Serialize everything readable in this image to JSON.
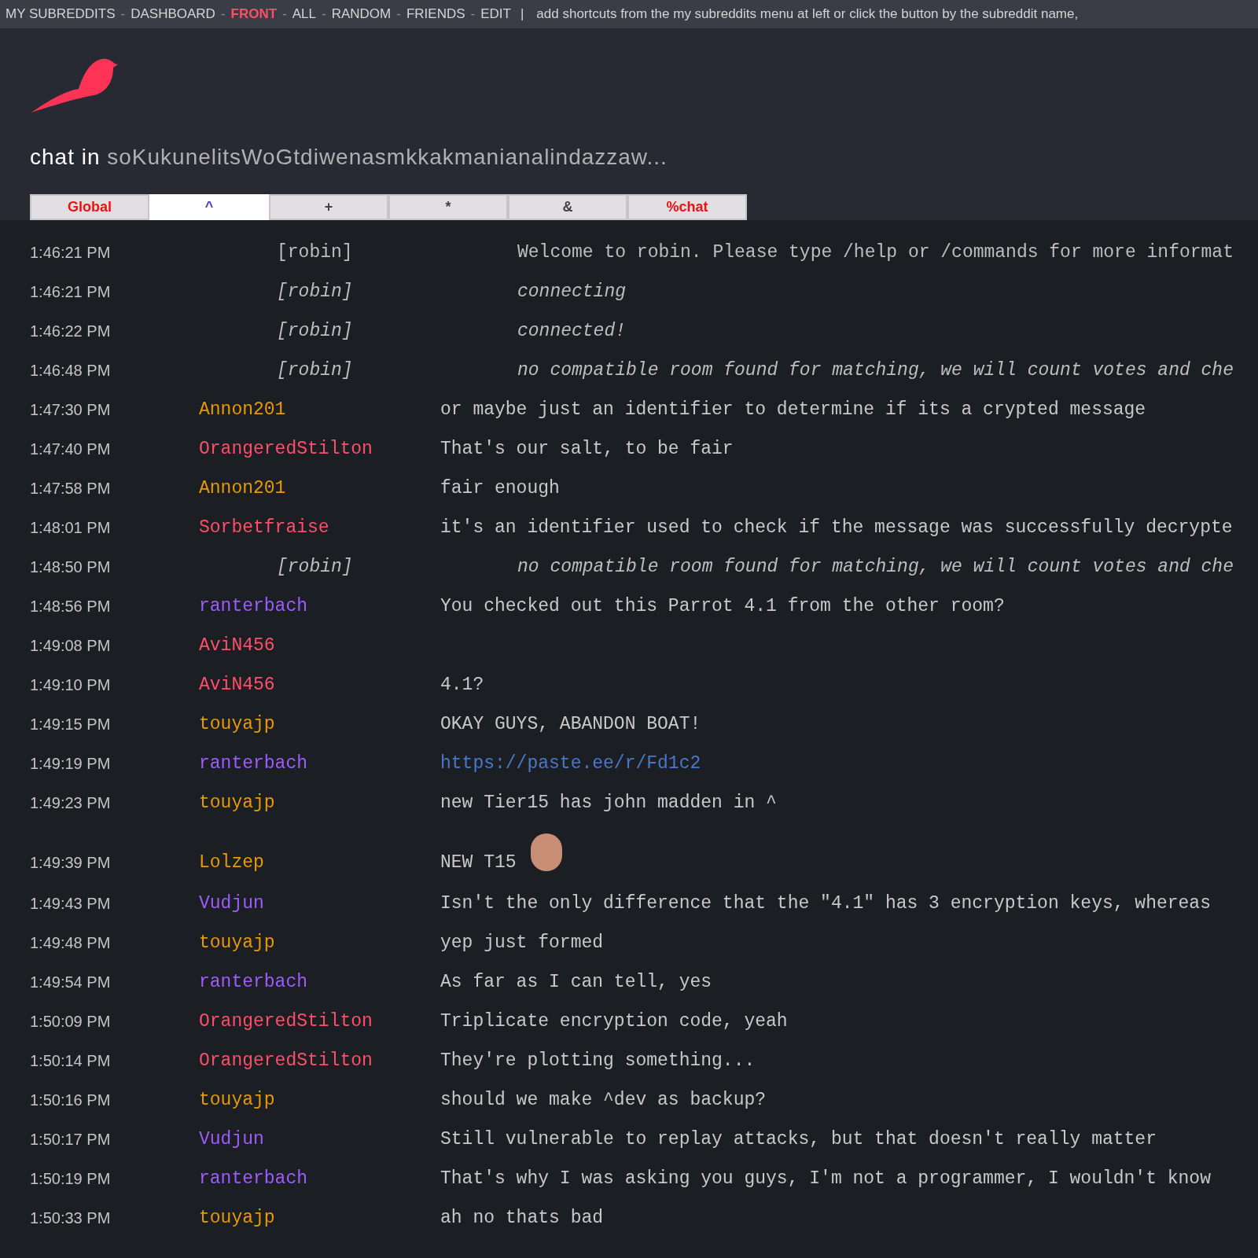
{
  "top_bar": {
    "separator": "-",
    "divider": "|",
    "links": [
      {
        "label": "MY SUBREDDITS",
        "selected": false
      },
      {
        "label": "DASHBOARD",
        "selected": false
      },
      {
        "label": "FRONT",
        "selected": true
      },
      {
        "label": "ALL",
        "selected": false
      },
      {
        "label": "RANDOM",
        "selected": false
      },
      {
        "label": "FRIENDS",
        "selected": false
      },
      {
        "label": "EDIT",
        "selected": false
      }
    ],
    "hint": "add shortcuts from the my subreddits menu at left or click the button by the subreddit name,"
  },
  "header": {
    "prefix": "chat in",
    "room": "soKukunelitsWoGtdiwenasmkkakmanianalindazzaw..."
  },
  "tabs": [
    {
      "label": "Global",
      "selected": false,
      "color": "#ee1111"
    },
    {
      "label": "^",
      "selected": true,
      "color": "#5533cc"
    },
    {
      "label": "+",
      "selected": false,
      "color": "#444444"
    },
    {
      "label": "*",
      "selected": false,
      "color": "#444444"
    },
    {
      "label": "&",
      "selected": false,
      "color": "#444444"
    },
    {
      "label": "%chat",
      "selected": false,
      "color": "#ee1111"
    }
  ],
  "messages": [
    {
      "kind": "system",
      "time": "1:46:21 PM",
      "user": "[robin]",
      "text": "Welcome to robin. Please type /help or /commands for more informat",
      "italic": false
    },
    {
      "kind": "system",
      "time": "1:46:21 PM",
      "user": "[robin]",
      "text": "connecting",
      "italic": true
    },
    {
      "kind": "system",
      "time": "1:46:22 PM",
      "user": "[robin]",
      "text": "connected!",
      "italic": true
    },
    {
      "kind": "system",
      "time": "1:46:48 PM",
      "user": "[robin]",
      "text": "no compatible room found for matching, we will count votes and che",
      "italic": true
    },
    {
      "kind": "chat",
      "time": "1:47:30 PM",
      "user": "Annon201",
      "color": "#e89a00",
      "text": "or maybe just an identifier to determine if its a crypted message"
    },
    {
      "kind": "chat",
      "time": "1:47:40 PM",
      "user": "OrangeredStilton",
      "color": "#ff4f68",
      "text": "That's our salt, to be fair"
    },
    {
      "kind": "chat",
      "time": "1:47:58 PM",
      "user": "Annon201",
      "color": "#e89a00",
      "text": "fair enough"
    },
    {
      "kind": "chat",
      "time": "1:48:01 PM",
      "user": "Sorbetfraise",
      "color": "#ff4f68",
      "text": "it's an identifier used to check if the message was successfully decrypte"
    },
    {
      "kind": "system",
      "time": "1:48:50 PM",
      "user": "[robin]",
      "text": "no compatible room found for matching, we will count votes and che",
      "italic": true
    },
    {
      "kind": "chat",
      "time": "1:48:56 PM",
      "user": "ranterbach",
      "color": "#9d5cff",
      "text": "You checked out this Parrot 4.1 from the other room?"
    },
    {
      "kind": "chat",
      "time": "1:49:08 PM",
      "user": "AviN456",
      "color": "#ff4f68"
    },
    {
      "kind": "chat",
      "time": "1:49:10 PM",
      "user": "AviN456",
      "color": "#ff4f68",
      "text": "4.1?"
    },
    {
      "kind": "chat",
      "time": "1:49:15 PM",
      "user": "touyajp",
      "color": "#e89a00",
      "text": "OKAY GUYS, ABANDON BOAT!"
    },
    {
      "kind": "chat",
      "time": "1:49:19 PM",
      "user": "ranterbach",
      "color": "#9d5cff",
      "text": "https://paste.ee/r/Fd1c2",
      "link": true
    },
    {
      "kind": "chat",
      "time": "1:49:23 PM",
      "user": "touyajp",
      "color": "#e89a00",
      "text": "new Tier15 has john madden in ^"
    },
    {
      "kind": "chat",
      "time": "1:49:39 PM",
      "user": "Lolzep",
      "color": "#e89a00",
      "text": "NEW T15",
      "emote": true
    },
    {
      "kind": "chat",
      "time": "1:49:43 PM",
      "user": "Vudjun",
      "color": "#9d5cff",
      "text": "Isn't the only difference that the \"4.1\" has 3 encryption keys, whereas"
    },
    {
      "kind": "chat",
      "time": "1:49:48 PM",
      "user": "touyajp",
      "color": "#e89a00",
      "text": "yep just formed"
    },
    {
      "kind": "chat",
      "time": "1:49:54 PM",
      "user": "ranterbach",
      "color": "#9d5cff",
      "text": "As far as I can tell, yes"
    },
    {
      "kind": "chat",
      "time": "1:50:09 PM",
      "user": "OrangeredStilton",
      "color": "#ff4f68",
      "text": "Triplicate encryption code, yeah"
    },
    {
      "kind": "chat",
      "time": "1:50:14 PM",
      "user": "OrangeredStilton",
      "color": "#ff4f68",
      "text": "They're plotting something..."
    },
    {
      "kind": "chat",
      "time": "1:50:16 PM",
      "user": "touyajp",
      "color": "#e89a00",
      "text": "should we make ^dev as backup?"
    },
    {
      "kind": "chat",
      "time": "1:50:17 PM",
      "user": "Vudjun",
      "color": "#9d5cff",
      "text": "Still vulnerable to replay attacks, but that doesn't really matter"
    },
    {
      "kind": "chat",
      "time": "1:50:19 PM",
      "user": "ranterbach",
      "color": "#9d5cff",
      "text": "That's why I was asking you guys, I'm not a programmer, I wouldn't know"
    },
    {
      "kind": "chat",
      "time": "1:50:33 PM",
      "user": "touyajp",
      "color": "#e89a00",
      "text": "ah no thats bad"
    }
  ]
}
